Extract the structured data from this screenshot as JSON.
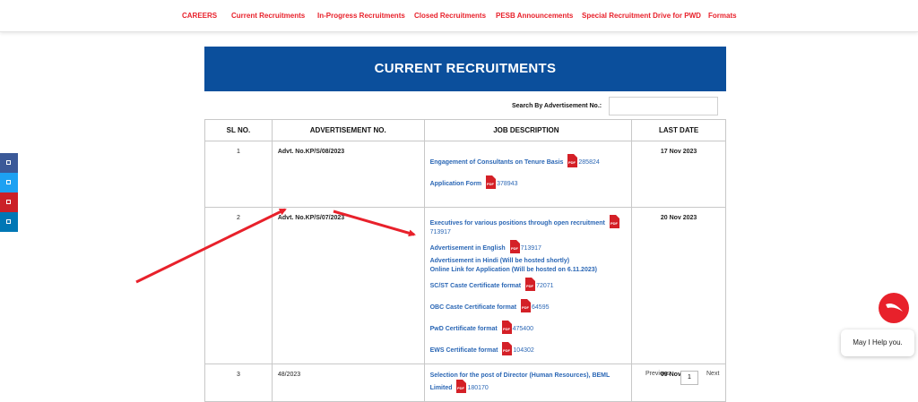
{
  "nav": {
    "items": [
      {
        "label": "CAREERS"
      },
      {
        "label": "Current Recruitments"
      },
      {
        "label": "In-Progress Recruitments"
      },
      {
        "label": "Closed Recruitments"
      },
      {
        "label": "PESB Announcements"
      },
      {
        "label": "Special Recruitment Drive for PWD"
      },
      {
        "label": "Formats"
      }
    ]
  },
  "banner": {
    "title": "CURRENT RECRUITMENTS"
  },
  "search": {
    "label": "Search By Advertisement No.:",
    "value": ""
  },
  "table": {
    "headers": [
      "SL NO.",
      "ADVERTISEMENT NO.",
      "JOB DESCRIPTION",
      "LAST DATE"
    ],
    "rows": [
      {
        "sl": "1",
        "adv": "Advt. No.KP/S/08/2023",
        "date": "17 Nov 2023",
        "jobs": [
          {
            "text": "Engagement of Consultants on Tenure Basis",
            "size": "285824"
          },
          {
            "text": "Application Form",
            "size": "378943"
          }
        ]
      },
      {
        "sl": "2",
        "adv": "Advt. No.KP/S/07/2023",
        "date": "20 Nov 2023",
        "jobs": [
          {
            "text": "Executives for various positions through open recruitment",
            "size": "713917"
          },
          {
            "text": "Advertisement in English",
            "size": "713917"
          },
          {
            "text": "Advertisement in Hindi (Will be hosted shortly)"
          },
          {
            "text": "Online Link for Application (Will be hosted on 6.11.2023)"
          },
          {
            "text": "SC/ST Caste Certificate format",
            "size": "72071"
          },
          {
            "text": "OBC Caste Certificate format",
            "size": "64595"
          },
          {
            "text": "PwD Certificate format",
            "size": "475400"
          },
          {
            "text": "EWS Certificate format",
            "size": "104302"
          }
        ]
      },
      {
        "sl": "3",
        "adv": "48/2023",
        "date": "09 Nov 2023",
        "jobs": [
          {
            "text": "Selection for the post of Director (Human Resources), BEML Limited",
            "size": "180170"
          }
        ]
      }
    ]
  },
  "pagination": {
    "previous": "Previous",
    "current": "1",
    "next": "Next"
  },
  "chat": {
    "bubble": "May I Help you."
  },
  "social": [
    {
      "icon": "facebook-icon",
      "color": "#3b5998"
    },
    {
      "icon": "twitter-icon",
      "color": "#1da1f2"
    },
    {
      "icon": "pinterest-icon",
      "color": "#cb2027"
    },
    {
      "icon": "linkedin-icon",
      "color": "#0077b5"
    }
  ],
  "colors": {
    "accent": "#e8212b",
    "banner": "#0b4f9c",
    "link": "#2b67b5"
  }
}
